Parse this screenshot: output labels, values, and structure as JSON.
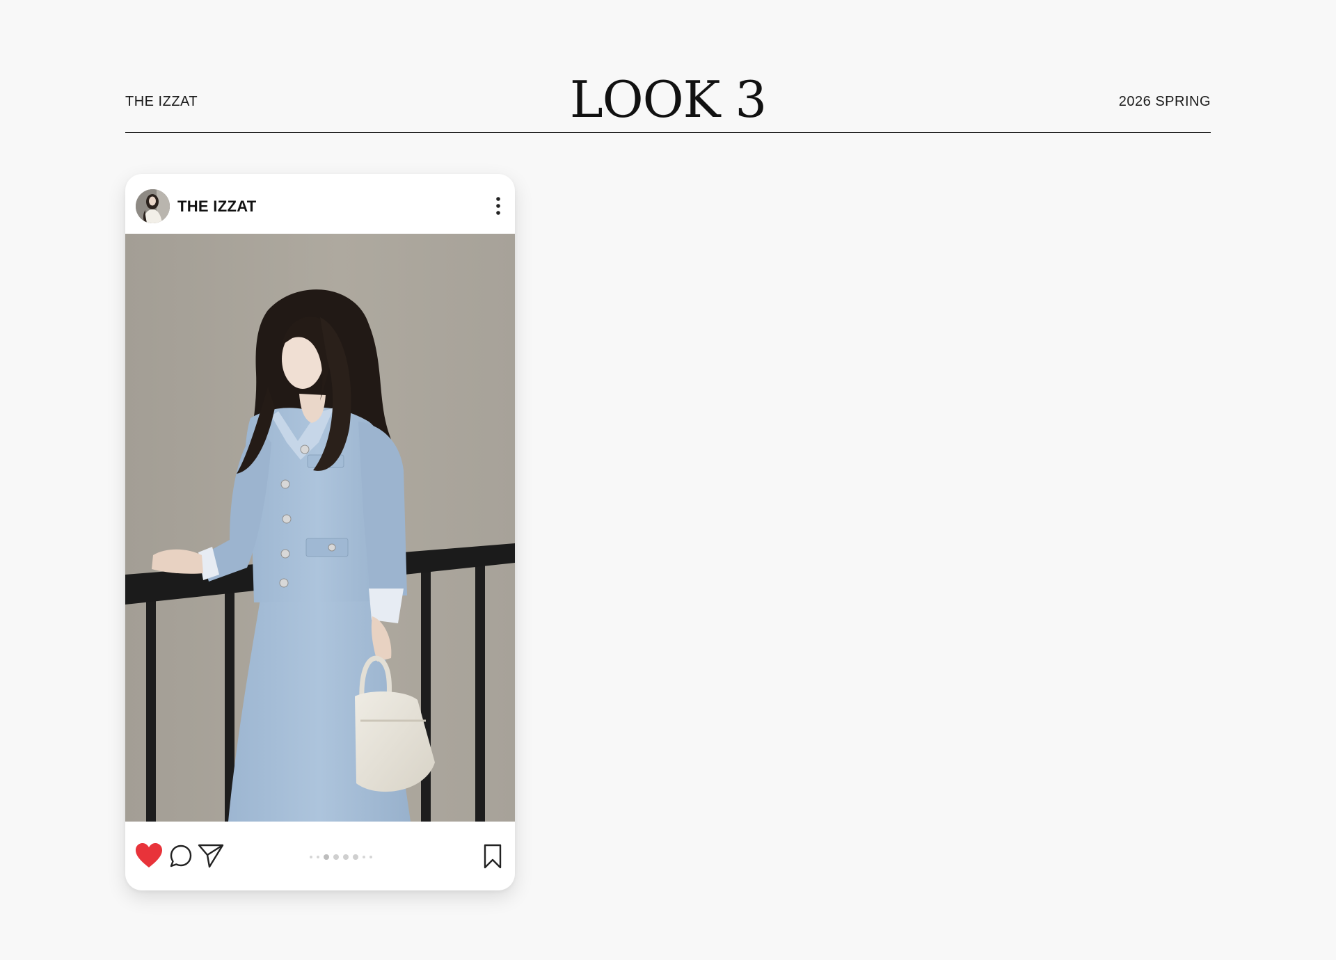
{
  "header": {
    "brand": "THE IZZAT",
    "title": "LOOK 3",
    "season": "2026 SPRING"
  },
  "post": {
    "username": "THE IZZAT",
    "liked": true,
    "like_color": "#e8333a",
    "carousel": {
      "total_dots": 7,
      "active_index": 2
    },
    "icons": [
      "more-vertical-icon",
      "heart-icon",
      "comment-icon",
      "share-icon",
      "bookmark-icon"
    ],
    "image_colors": {
      "wall": "#a9a49c",
      "outfit": "#a8c0da",
      "railing": "#1c1c1c",
      "bag": "#e6e2d8",
      "hair": "#221a16"
    }
  }
}
